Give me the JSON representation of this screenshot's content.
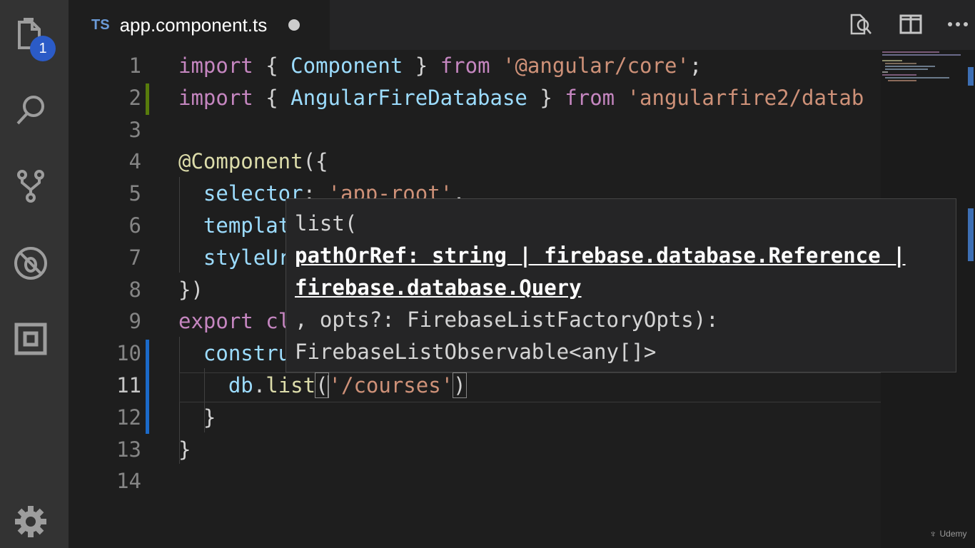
{
  "activity_bar": {
    "items": [
      {
        "name": "explorer",
        "icon": "files-icon"
      },
      {
        "name": "search",
        "icon": "search-icon"
      },
      {
        "name": "source-control",
        "icon": "source-control-icon"
      },
      {
        "name": "debug",
        "icon": "debug-icon"
      },
      {
        "name": "extensions",
        "icon": "extensions-icon"
      }
    ],
    "explorer_badge": "1",
    "settings_icon": "gear-icon"
  },
  "tab": {
    "lang": "TS",
    "filename": "app.component.ts",
    "dirty_indicator": "dot-icon"
  },
  "editor_actions": [
    "open-preview-icon",
    "split-editor-icon",
    "more-actions-icon"
  ],
  "code_lines": [
    {
      "n": "1",
      "tokens": [
        [
          "kw",
          "import"
        ],
        [
          "pl",
          " { "
        ],
        [
          "id",
          "Component"
        ],
        [
          "pl",
          " } "
        ],
        [
          "kw",
          "from"
        ],
        [
          "pl",
          " "
        ],
        [
          "st",
          "'@angular/core'"
        ],
        [
          "pl",
          ";"
        ]
      ]
    },
    {
      "n": "2",
      "tokens": [
        [
          "kw",
          "import"
        ],
        [
          "pl",
          " { "
        ],
        [
          "id",
          "AngularFireDatabase"
        ],
        [
          "pl",
          " } "
        ],
        [
          "kw",
          "from"
        ],
        [
          "pl",
          " "
        ],
        [
          "st",
          "'angularfire2/datab"
        ]
      ]
    },
    {
      "n": "3",
      "tokens": []
    },
    {
      "n": "4",
      "tokens": [
        [
          "dec",
          "@Component"
        ],
        [
          "pl",
          "({"
        ]
      ]
    },
    {
      "n": "5",
      "tokens": [
        [
          "pl",
          "  "
        ],
        [
          "id",
          "selector"
        ],
        [
          "pl",
          ": "
        ],
        [
          "st",
          "'app-root'"
        ],
        [
          "pl",
          ","
        ]
      ]
    },
    {
      "n": "6",
      "tokens": [
        [
          "pl",
          "  "
        ],
        [
          "id",
          "templat"
        ]
      ]
    },
    {
      "n": "7",
      "tokens": [
        [
          "pl",
          "  "
        ],
        [
          "id",
          "styleUr"
        ]
      ]
    },
    {
      "n": "8",
      "tokens": [
        [
          "pl",
          "})"
        ]
      ]
    },
    {
      "n": "9",
      "tokens": [
        [
          "kw",
          "export"
        ],
        [
          "pl",
          " "
        ],
        [
          "kw",
          "cl"
        ]
      ]
    },
    {
      "n": "10",
      "tokens": [
        [
          "pl",
          "  "
        ],
        [
          "id",
          "constru"
        ]
      ]
    },
    {
      "n": "11",
      "tokens": [
        [
          "pl",
          "    "
        ],
        [
          "id",
          "db"
        ],
        [
          "pl",
          "."
        ],
        [
          "fn",
          "list"
        ],
        [
          "br",
          "("
        ],
        [
          "cur",
          ""
        ],
        [
          "st",
          "'/courses'"
        ],
        [
          "br",
          ")"
        ]
      ]
    },
    {
      "n": "12",
      "tokens": [
        [
          "pl",
          "  }"
        ]
      ]
    },
    {
      "n": "13",
      "tokens": [
        [
          "pl",
          "}"
        ]
      ]
    },
    {
      "n": "14",
      "tokens": []
    }
  ],
  "hint": {
    "line1": "list(",
    "param_line1": "pathOrRef: string | firebase.database.Reference |",
    "param_line2": "firebase.database.Query",
    "line4": ", opts?: FirebaseListFactoryOpts):",
    "line5": "FirebaseListObservable<any[]>"
  },
  "watermark": "Udemy"
}
